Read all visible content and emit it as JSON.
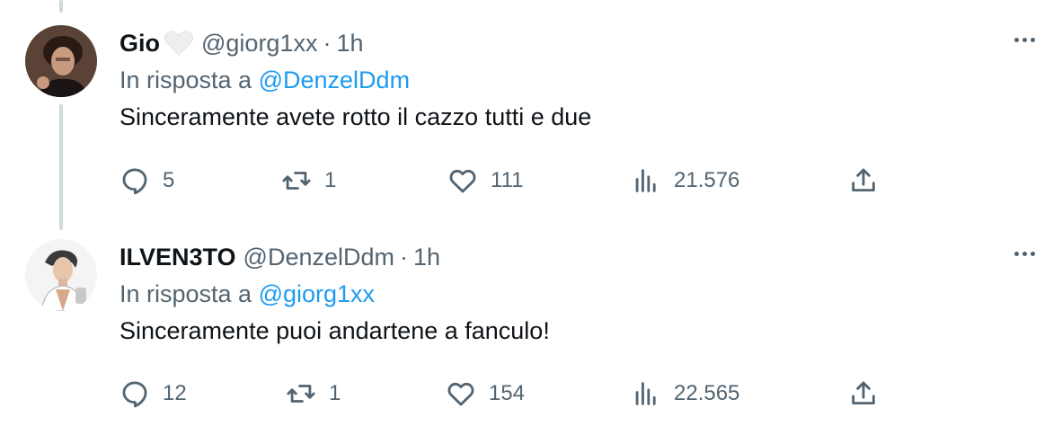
{
  "tweets": [
    {
      "name": "Gio",
      "handle": "@giorg1xx",
      "separator": "·",
      "time": "1h",
      "reply_prefix": "In risposta a",
      "reply_to": "@DenzelDdm",
      "text": "Sinceramente avete rotto il cazzo tutti e due",
      "replies": "5",
      "retweets": "1",
      "likes": "111",
      "views": "21.576"
    },
    {
      "name": "ILVEN3TO",
      "handle": "@DenzelDdm",
      "separator": "·",
      "time": "1h",
      "reply_prefix": "In risposta a",
      "reply_to": "@giorg1xx",
      "text": "Sinceramente puoi andartene a fanculo!",
      "replies": "12",
      "retweets": "1",
      "likes": "154",
      "views": "22.565"
    }
  ],
  "colors": {
    "text": "#0f1419",
    "secondary": "#536471",
    "link": "#1d9bf0",
    "thread_line": "#cfd9de"
  }
}
